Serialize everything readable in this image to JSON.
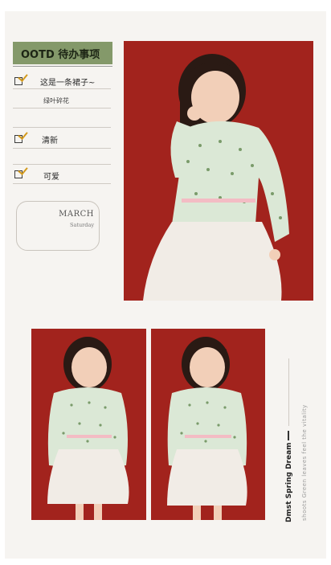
{
  "header": {
    "tag": "OOTD  待办事项"
  },
  "checklist": [
    {
      "text": "这是一条裙子~",
      "note": "绿叶碎花"
    },
    {
      "text": "清新"
    },
    {
      "text": "可爱"
    }
  ],
  "date_card": {
    "month": "MARCH",
    "weekday": "Saturday"
  },
  "side_caption": {
    "title": "Dmst Spring Dream",
    "subtitle": "shoots  Green leaves feel the vitality"
  },
  "colors": {
    "backdrop_red": "#a2231d",
    "tag_green": "#84996a",
    "tick_orange": "#d39a1d"
  }
}
